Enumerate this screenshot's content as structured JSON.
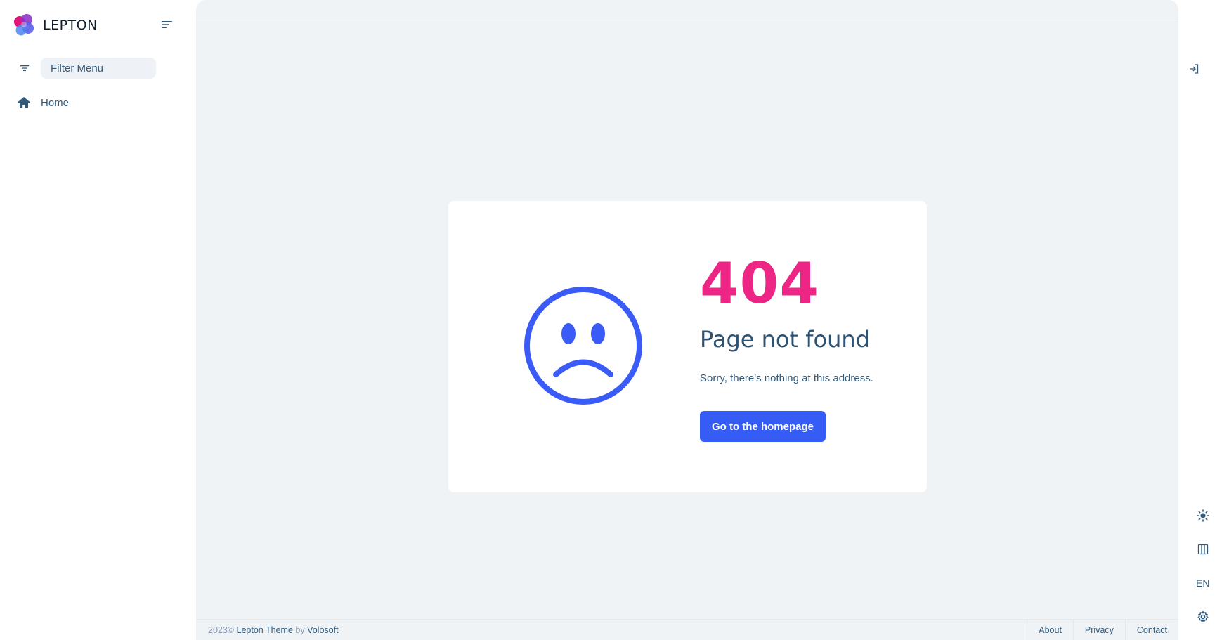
{
  "brand": {
    "name": "LEPTON"
  },
  "sidebar": {
    "filter_placeholder": "Filter Menu",
    "items": [
      {
        "label": "Home",
        "icon": "home-icon"
      }
    ]
  },
  "error": {
    "code": "404",
    "title": "Page not found",
    "message": "Sorry, there's nothing at this address.",
    "button_label": "Go to the homepage"
  },
  "footer": {
    "year": "2023©",
    "product": "Lepton Theme",
    "by": "by",
    "company": "Volosoft",
    "links": [
      "About",
      "Privacy",
      "Contact"
    ]
  },
  "rail": {
    "language": "EN",
    "icons": [
      "login-icon",
      "sun-icon",
      "columns-icon",
      "gear-icon"
    ]
  },
  "colors": {
    "accent": "#355df5",
    "error_code": "#ed2686",
    "text": "#325a7a",
    "main_bg": "#eff3f6"
  }
}
